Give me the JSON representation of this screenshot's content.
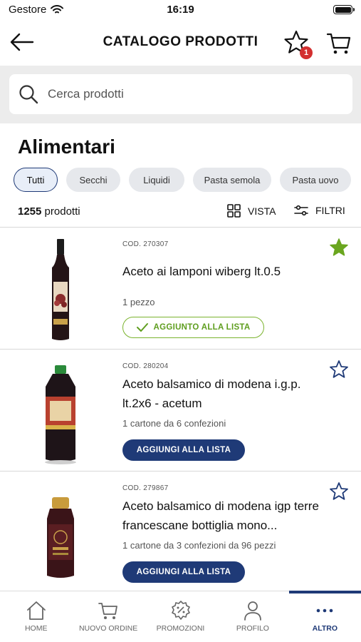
{
  "status_bar": {
    "carrier": "Gestore",
    "time": "16:19"
  },
  "header": {
    "title": "CATALOGO PRODOTTI",
    "favorites_badge": "1"
  },
  "search": {
    "placeholder": "Cerca prodotti"
  },
  "category": {
    "title": "Alimentari",
    "filters": [
      {
        "label": "Tutti",
        "active": true
      },
      {
        "label": "Secchi",
        "active": false
      },
      {
        "label": "Liquidi",
        "active": false
      },
      {
        "label": "Pasta semola",
        "active": false
      },
      {
        "label": "Pasta uovo",
        "active": false
      }
    ],
    "count": "1255",
    "count_label": "prodotti",
    "view_label": "VISTA",
    "filter_label": "FILTRI"
  },
  "products": [
    {
      "code": "COD. 270307",
      "name": "Aceto ai lamponi wiberg lt.0.5",
      "unit": "1 pezzo",
      "favorite": true,
      "action_label": "AGGIUNTO ALLA LISTA",
      "added": true
    },
    {
      "code": "COD. 280204",
      "name": "Aceto balsamico di modena i.g.p. lt.2x6 - acetum",
      "unit": "1 cartone da 6 confezioni",
      "favorite": false,
      "action_label": "AGGIUNGI ALLA LISTA",
      "added": false
    },
    {
      "code": "COD. 279867",
      "name": "Aceto balsamico di modena igp terre francescane bottiglia mono...",
      "unit": "1 cartone da 3 confezioni da 96 pezzi",
      "favorite": false,
      "action_label": "AGGIUNGI ALLA LISTA",
      "added": false
    }
  ],
  "tabbar": {
    "items": [
      {
        "label": "HOME",
        "icon": "home-icon"
      },
      {
        "label": "NUOVO ORDINE",
        "icon": "cart-icon"
      },
      {
        "label": "PROMOZIONI",
        "icon": "promo-percent-icon"
      },
      {
        "label": "PROFILO",
        "icon": "person-icon"
      },
      {
        "label": "ALTRO",
        "icon": "more-dots-icon",
        "active": true
      }
    ]
  },
  "colors": {
    "primary": "#1f3a77",
    "added_green": "#7bb32e",
    "badge_red": "#d32f2f",
    "search_band": "#ececec"
  }
}
